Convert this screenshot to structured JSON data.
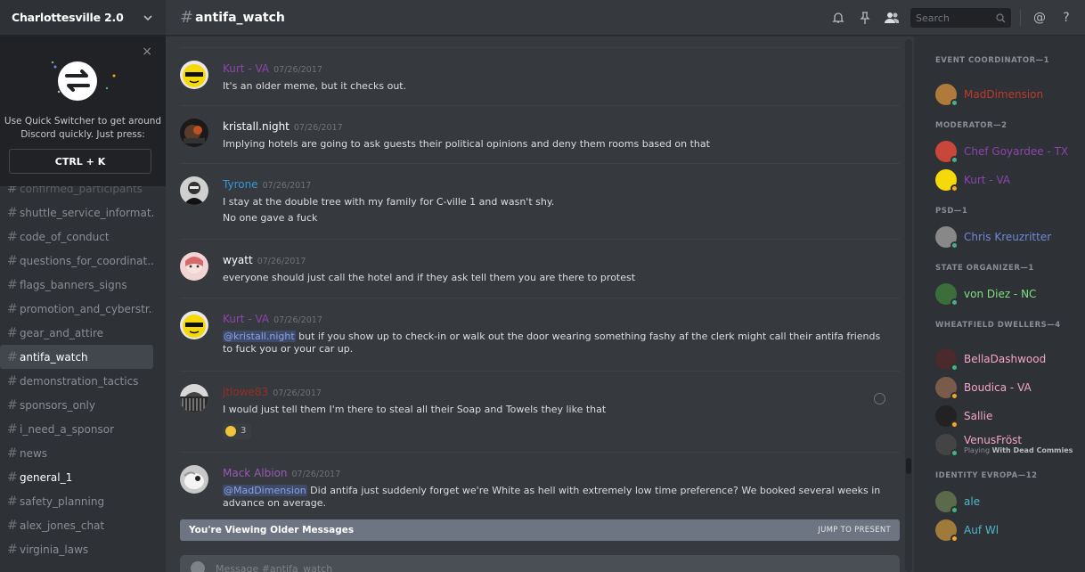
{
  "server": {
    "name": "Charlottesville 2.0"
  },
  "quick_switcher": {
    "text_line1": "Use Quick Switcher to get around",
    "text_line2": "Discord quickly. Just press:",
    "shortcut": "CTRL + K",
    "close": "×"
  },
  "channels": [
    {
      "name": "confirmed_participants",
      "state": "faded"
    },
    {
      "name": "shuttle_service_informat...",
      "state": "normal"
    },
    {
      "name": "code_of_conduct",
      "state": "normal"
    },
    {
      "name": "questions_for_coordinat...",
      "state": "normal"
    },
    {
      "name": "flags_banners_signs",
      "state": "normal"
    },
    {
      "name": "promotion_and_cyberstr...",
      "state": "normal"
    },
    {
      "name": "gear_and_attire",
      "state": "normal"
    },
    {
      "name": "antifa_watch",
      "state": "active"
    },
    {
      "name": "demonstration_tactics",
      "state": "normal"
    },
    {
      "name": "sponsors_only",
      "state": "normal"
    },
    {
      "name": "i_need_a_sponsor",
      "state": "normal"
    },
    {
      "name": "news",
      "state": "normal"
    },
    {
      "name": "general_1",
      "state": "unread"
    },
    {
      "name": "safety_planning",
      "state": "normal"
    },
    {
      "name": "alex_jones_chat",
      "state": "normal"
    },
    {
      "name": "virginia_laws",
      "state": "normal"
    }
  ],
  "header": {
    "hash": "#",
    "channel": "antifa_watch",
    "search_placeholder": "Search",
    "icons": [
      "bell-icon",
      "pin-icon",
      "members-icon",
      "mention-icon",
      "help-icon"
    ],
    "at": "@",
    "help": "?"
  },
  "messages": [
    {
      "author": "Kurt - VA",
      "color": "#8e44ad",
      "timestamp": "07/26/2017",
      "lines": [
        "It's an older meme, but it checks out."
      ]
    },
    {
      "author": "kristall.night",
      "color": "#ffffff",
      "timestamp": "07/26/2017",
      "lines": [
        "Implying hotels are going to ask guests their political opinions and deny them rooms based on that"
      ]
    },
    {
      "author": "Tyrone",
      "color": "#3498db",
      "timestamp": "07/26/2017",
      "lines": [
        "I stay at the double tree with my family for C-ville 1 and wasn't shy.",
        "No one gave a fuck"
      ]
    },
    {
      "author": "wyatt",
      "color": "#ffffff",
      "timestamp": "07/26/2017",
      "lines": [
        "everyone should just call the hotel and if they ask tell them you are there to protest"
      ]
    },
    {
      "author": "Kurt - VA",
      "color": "#8e44ad",
      "timestamp": "07/26/2017",
      "mention": "@kristall.night",
      "lines": [
        " but if you show up to check-in or walk out the door wearing something fashy af the clerk might call their antifa friends to fuck you or your car up."
      ]
    },
    {
      "author": "jtlowe83",
      "color": "#992d22",
      "timestamp": "07/26/2017",
      "lines": [
        "I would just tell them I'm there to steal all their Soap and Towels they like that"
      ],
      "reaction_count": "3"
    },
    {
      "author": "Mack Albion",
      "color": "#9b59b6",
      "timestamp": "07/26/2017",
      "mention": "@MadDimension",
      "lines": [
        " Did antifa just suddenly forget we're White as hell with extremely low time preference? We booked several weeks in advance on average."
      ]
    }
  ],
  "older_bar": {
    "text": "You're Viewing Older Messages",
    "jump": "JUMP TO PRESENT"
  },
  "composer": {
    "placeholder": "Message #antifa_watch"
  },
  "roles": [
    {
      "title": "EVENT COORDINATOR—1",
      "members": [
        {
          "name": "MadDimension",
          "color": "#c0392b",
          "status": "online"
        }
      ]
    },
    {
      "title": "MODERATOR—2",
      "members": [
        {
          "name": "Chef Goyardee - TX",
          "color": "#8e44ad",
          "status": "online"
        },
        {
          "name": "Kurt - VA",
          "color": "#8e44ad",
          "status": "idle"
        }
      ]
    },
    {
      "title": "PSD—1",
      "members": [
        {
          "name": "Chris Kreuzritter",
          "color": "#6d8ad6",
          "status": "online"
        }
      ]
    },
    {
      "title": "STATE ORGANIZER—1",
      "members": [
        {
          "name": "von Diez - NC",
          "color": "#7fe07f",
          "status": "online"
        }
      ]
    },
    {
      "title": "WHEATFIELD DWELLERS—4",
      "members": [
        {
          "name": "BellaDashwood",
          "color": "#f4a6c6",
          "status": "online"
        },
        {
          "name": "Boudica - VA",
          "color": "#f4a6c6",
          "status": "idle"
        },
        {
          "name": "Sallie",
          "color": "#f4a6c6",
          "status": "idle"
        },
        {
          "name": "VenusFröst",
          "color": "#f4a6c6",
          "status": "online",
          "playing_prefix": "Playing ",
          "playing": "With Dead Commies"
        }
      ]
    },
    {
      "title": "IDENTITY EVROPA—12",
      "members": [
        {
          "name": "ale",
          "color": "#4fb8c9",
          "status": "online"
        },
        {
          "name": "Auf Wl",
          "color": "#4fb8c9",
          "status": "idle"
        }
      ]
    }
  ],
  "colors": {
    "online": "#43b581",
    "idle": "#faa61a",
    "background": "#36393e",
    "sidebar": "#2e3136"
  }
}
